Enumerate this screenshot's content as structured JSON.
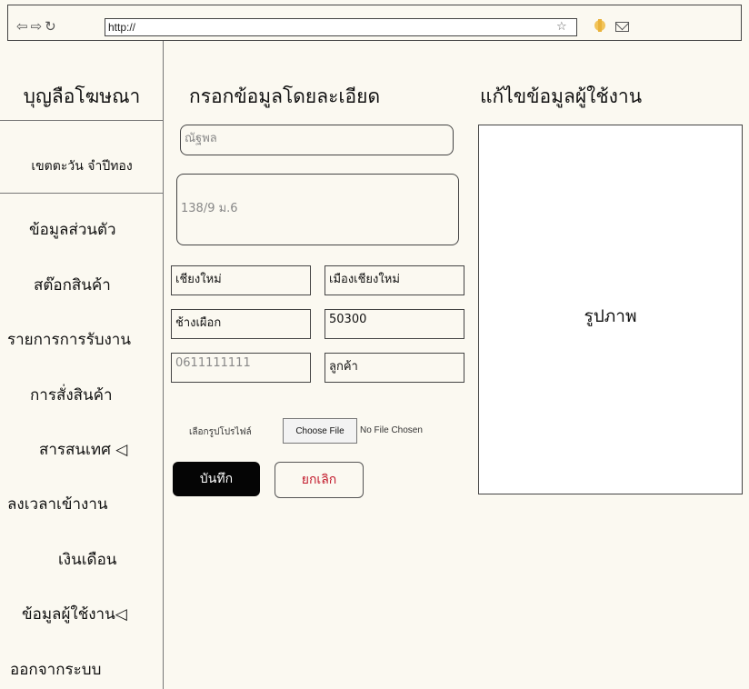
{
  "browser": {
    "url": "http://"
  },
  "sidebar": {
    "brand": "บุญลือโฆษณา",
    "username": "เขตตะวัน จำปีทอง",
    "items": [
      {
        "label": "ข้อมูลส่วนตัว"
      },
      {
        "label": "สต๊อกสินค้า"
      },
      {
        "label": "รายการการรับงาน"
      },
      {
        "label": "การสั่งสินค้า"
      },
      {
        "label": "สารสนเทศ ◁"
      },
      {
        "label": "ลงเวลาเข้างาน"
      },
      {
        "label": "เงินเดือน"
      },
      {
        "label": "ข้อมูลผู้ใช้งาน◁"
      },
      {
        "label": "ออกจากระบบ"
      }
    ]
  },
  "form": {
    "heading": "กรอกข้อมูลโดยละเอียด",
    "fields": {
      "name": "ณัฐพล",
      "address": "138/9 ม.6",
      "province": "เชียงใหม่",
      "district": "เมืองเชียงใหม่",
      "subdistrict": "ช้างเผือก",
      "postal_code": "50300",
      "phone": "0611111111",
      "role": "ลูกค้า"
    },
    "upload": {
      "label": "เลือกรูปโปรไฟล์",
      "button": "Choose File",
      "status": "No File Chosen"
    },
    "save_label": "บันทึก",
    "cancel_label": "ยกเลิก"
  },
  "edit_panel": {
    "heading": "แก้ไขข้อมูลผู้ใช้งาน",
    "image_label": "รูปภาพ"
  },
  "colors": {
    "background": "#fbf9f1",
    "save_button": "#050505",
    "cancel_text": "#c2192b"
  }
}
